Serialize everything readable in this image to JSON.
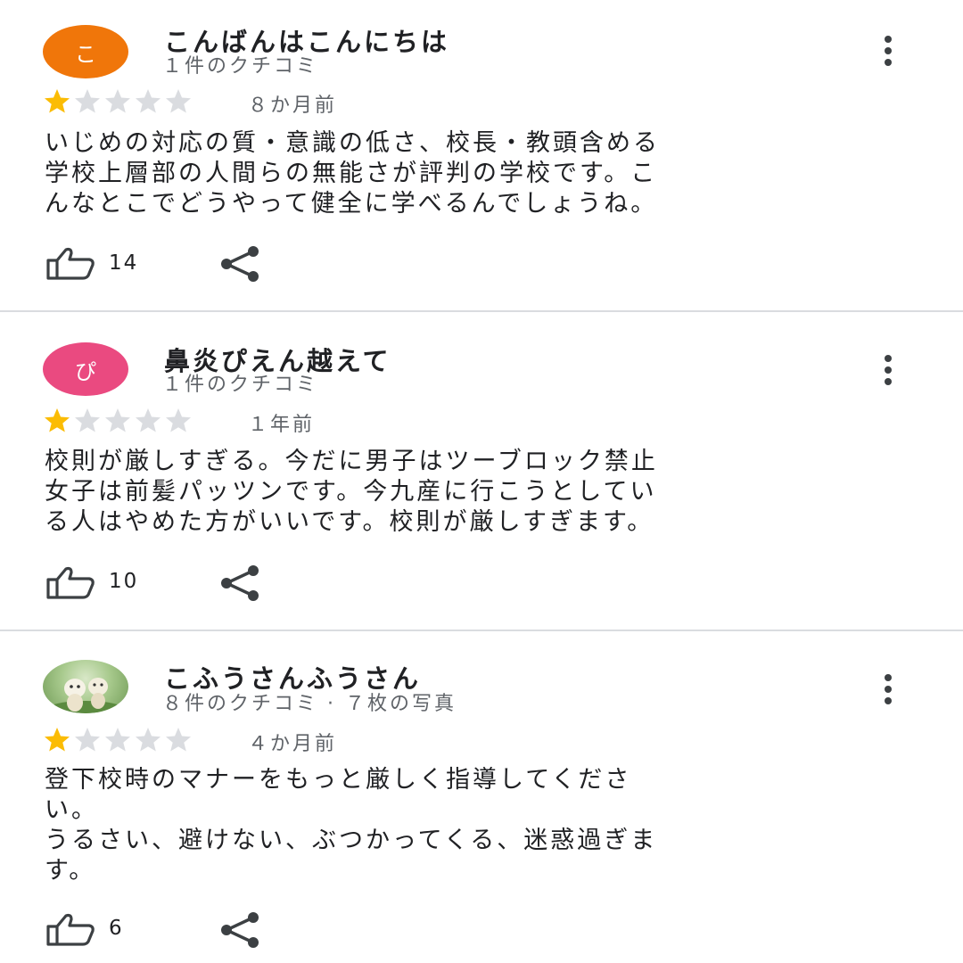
{
  "colors": {
    "star_filled": "#fbbc04",
    "star_empty": "#dadce0",
    "divider": "#dadce0"
  },
  "reviews": [
    {
      "author": "こんばんはこんにちは",
      "avatar_letter": "こ",
      "avatar_color": "#f0760a",
      "meta": "１件のクチコミ",
      "rating": 1,
      "date": "８か月前",
      "text": "いじめの対応の質・意識の低さ、校長・教頭含める\n学校上層部の人間らの無能さが評判の学校です。こ\nんなとこでどうやって健全に学べるんでしょうね。",
      "likes": "14",
      "like_icon": "thumb-up-icon",
      "share_icon": "share-icon",
      "more_icon": "more-vert-icon"
    },
    {
      "author": "鼻炎ぴえん越えて",
      "avatar_letter": "ぴ",
      "avatar_color": "#ea4a80",
      "meta": "１件のクチコミ",
      "rating": 1,
      "date": "１年前",
      "text": "校則が厳しすぎる。今だに男子はツーブロック禁止\n女子は前髪パッツンです。今九産に行こうとしてい\nる人はやめた方がいいです。校則が厳しすぎます。",
      "likes": "10",
      "like_icon": "thumb-up-icon",
      "share_icon": "share-icon",
      "more_icon": "more-vert-icon"
    },
    {
      "author": "こふうさんふうさん",
      "avatar_letter": "",
      "avatar_color": "#8fb87a",
      "meta": "８件のクチコミ · ７枚の写真",
      "rating": 1,
      "date": "４か月前",
      "text": "登下校時のマナーをもっと厳しく指導してくださ\nい。\nうるさい、避けない、ぶつかってくる、迷惑過ぎま\nす。",
      "likes": "6",
      "like_icon": "thumb-up-icon",
      "share_icon": "share-icon",
      "more_icon": "more-vert-icon"
    }
  ]
}
